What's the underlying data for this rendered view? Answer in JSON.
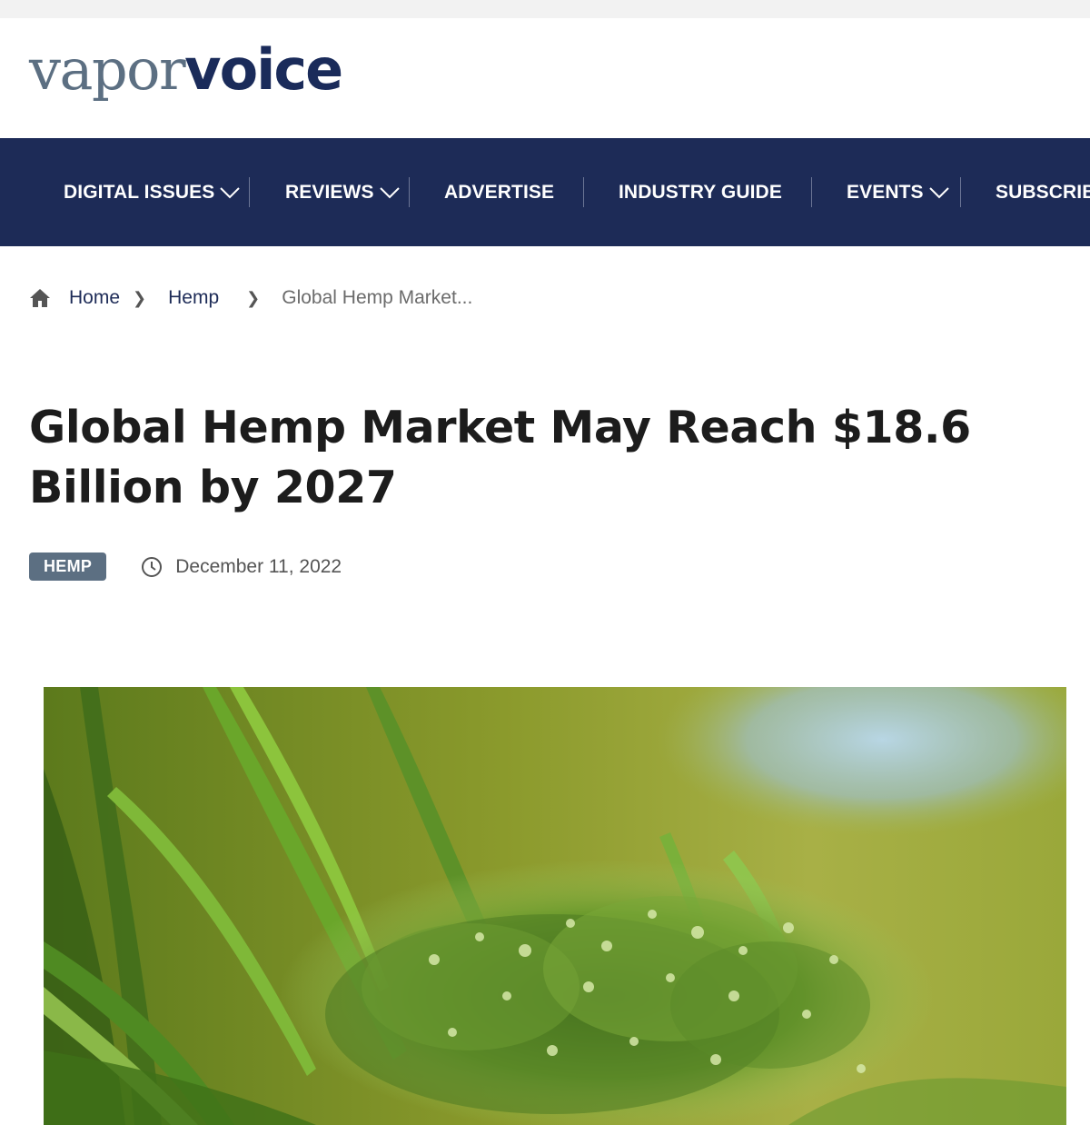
{
  "brand": {
    "logo_light": "vapor",
    "logo_bold": "voice",
    "colors": {
      "navy": "#1d2b57",
      "slate": "#5c6f82"
    }
  },
  "nav": {
    "items": [
      {
        "label": "DIGITAL ISSUES",
        "has_dropdown": true
      },
      {
        "label": "REVIEWS",
        "has_dropdown": true
      },
      {
        "label": "ADVERTISE",
        "has_dropdown": false
      },
      {
        "label": "INDUSTRY GUIDE",
        "has_dropdown": false
      },
      {
        "label": "EVENTS",
        "has_dropdown": true
      },
      {
        "label": "SUBSCRIB",
        "has_dropdown": false
      }
    ]
  },
  "breadcrumb": {
    "home_icon": "home-icon",
    "home": "Home",
    "category": "Hemp",
    "current": "Global Hemp Market..."
  },
  "article": {
    "title": "Global Hemp Market May Reach $18.6 Billion by 2027",
    "tag": "HEMP",
    "date_icon": "clock-icon",
    "date": "December 11, 2022",
    "hero_image": "hemp-plant-photo"
  }
}
